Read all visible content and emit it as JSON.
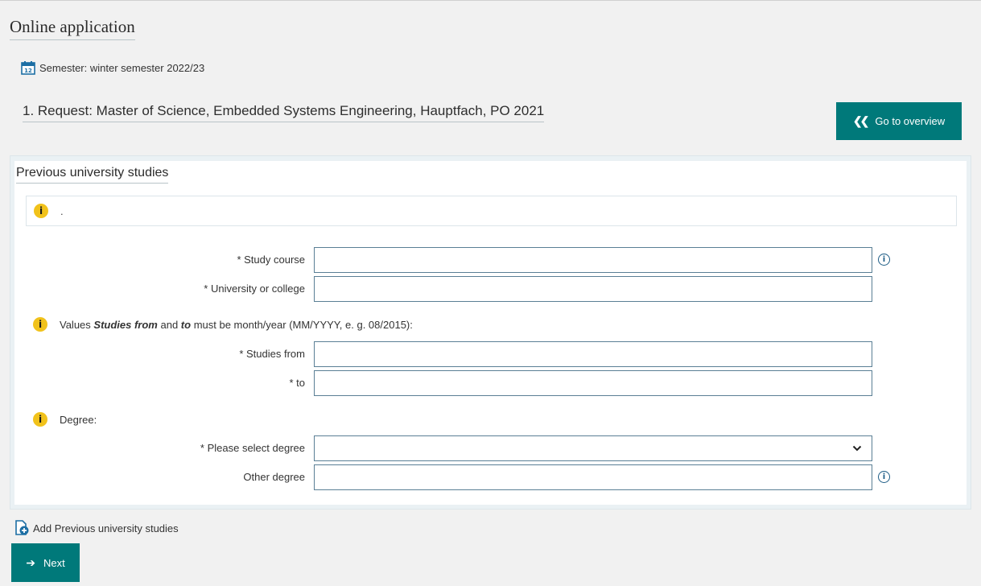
{
  "header": {
    "title": "Online application",
    "semester": "Semester: winter semester 2022/23",
    "request": "1. Request: Master of Science, Embedded Systems Engineering, Hauptfach, PO 2021",
    "overview_button": "Go to overview"
  },
  "section": {
    "title": "Previous university studies",
    "info_text": "."
  },
  "form": {
    "study_course": {
      "label": "* Study course",
      "value": ""
    },
    "university": {
      "label": "* University or college",
      "value": ""
    },
    "dates_note": {
      "prefix": "Values ",
      "studies_from_em": "Studies from",
      "and": " and ",
      "to_em": "to",
      "suffix": " must be month/year (MM/YYYY, e. g. 08/2015):"
    },
    "studies_from": {
      "label": "* Studies from",
      "value": ""
    },
    "studies_to": {
      "label": "* to",
      "value": ""
    },
    "degree_note": "Degree:",
    "degree_select": {
      "label": "* Please select degree",
      "selected": ""
    },
    "other_degree": {
      "label": "Other degree",
      "value": ""
    }
  },
  "actions": {
    "add_link": "Add Previous university studies",
    "next_button": "Next"
  },
  "colors": {
    "accent": "#00797a",
    "info_yellow": "#f1c21b",
    "info_blue": "#1d5c85"
  }
}
